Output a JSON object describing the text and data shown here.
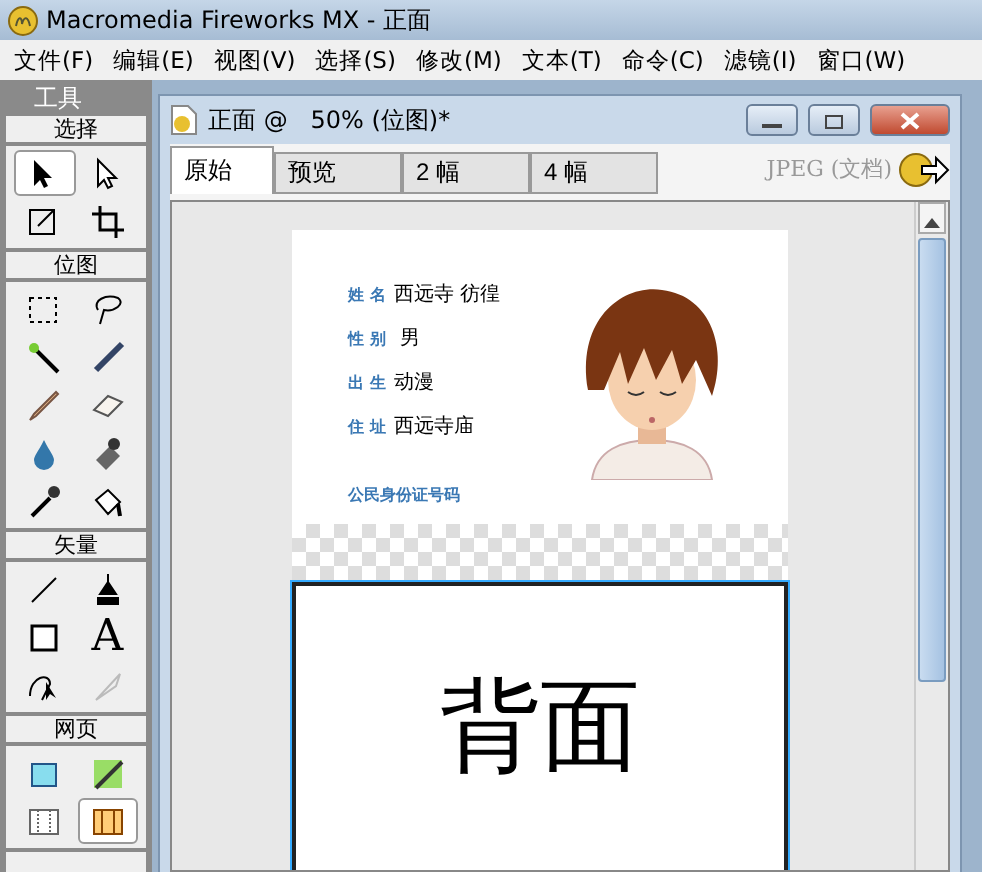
{
  "window": {
    "title": "Macromedia Fireworks MX - 正面"
  },
  "menu": [
    "文件(F)",
    "编辑(E)",
    "视图(V)",
    "选择(S)",
    "修改(M)",
    "文本(T)",
    "命令(C)",
    "滤镜(I)",
    "窗口(W)"
  ],
  "tools_panel": {
    "title": "工具",
    "sections": [
      {
        "title": "选择",
        "tools": [
          {
            "kind": "pointer",
            "selected": true
          },
          {
            "kind": "subselect",
            "selected": false
          },
          {
            "kind": "scale",
            "selected": false
          },
          {
            "kind": "crop",
            "selected": false
          }
        ]
      },
      {
        "title": "位图",
        "tools": [
          {
            "kind": "marquee",
            "selected": false
          },
          {
            "kind": "lasso",
            "selected": false
          },
          {
            "kind": "wand",
            "selected": false
          },
          {
            "kind": "brush",
            "selected": false
          },
          {
            "kind": "pencil",
            "selected": false
          },
          {
            "kind": "eraser",
            "selected": false
          },
          {
            "kind": "blur",
            "selected": false
          },
          {
            "kind": "stamp",
            "selected": false
          },
          {
            "kind": "eyedropper",
            "selected": false
          },
          {
            "kind": "bucket",
            "selected": false
          }
        ]
      },
      {
        "title": "矢量",
        "tools": [
          {
            "kind": "line",
            "selected": false
          },
          {
            "kind": "pen",
            "selected": false
          },
          {
            "kind": "rectangle",
            "selected": false
          },
          {
            "kind": "text",
            "label": "A",
            "selected": false
          },
          {
            "kind": "freeform",
            "selected": false
          },
          {
            "kind": "knife",
            "selected": false
          }
        ]
      },
      {
        "title": "网页",
        "tools": [
          {
            "kind": "hotspot",
            "selected": false
          },
          {
            "kind": "slice",
            "selected": false
          },
          {
            "kind": "hide-slices",
            "selected": false
          },
          {
            "kind": "show-slices",
            "selected": true
          }
        ]
      }
    ]
  },
  "document": {
    "title": "正面 @   50% (位图)*",
    "tabs": [
      {
        "label": "原始",
        "selected": true
      },
      {
        "label": "预览",
        "selected": false
      },
      {
        "label": "2 幅",
        "selected": false
      },
      {
        "label": "4 幅",
        "selected": false
      }
    ],
    "format": "JPEG (文档)",
    "front_card": {
      "fields": [
        {
          "label": "姓 名",
          "value": "西远寺 彷徨"
        },
        {
          "label": "性 别",
          "value": " 男"
        },
        {
          "label": "出 生",
          "value": "动漫"
        },
        {
          "label": "住 址",
          "value": "西远寺庙"
        }
      ],
      "id_label": "公民身份证号码"
    },
    "back_card": {
      "text": "背面"
    }
  }
}
